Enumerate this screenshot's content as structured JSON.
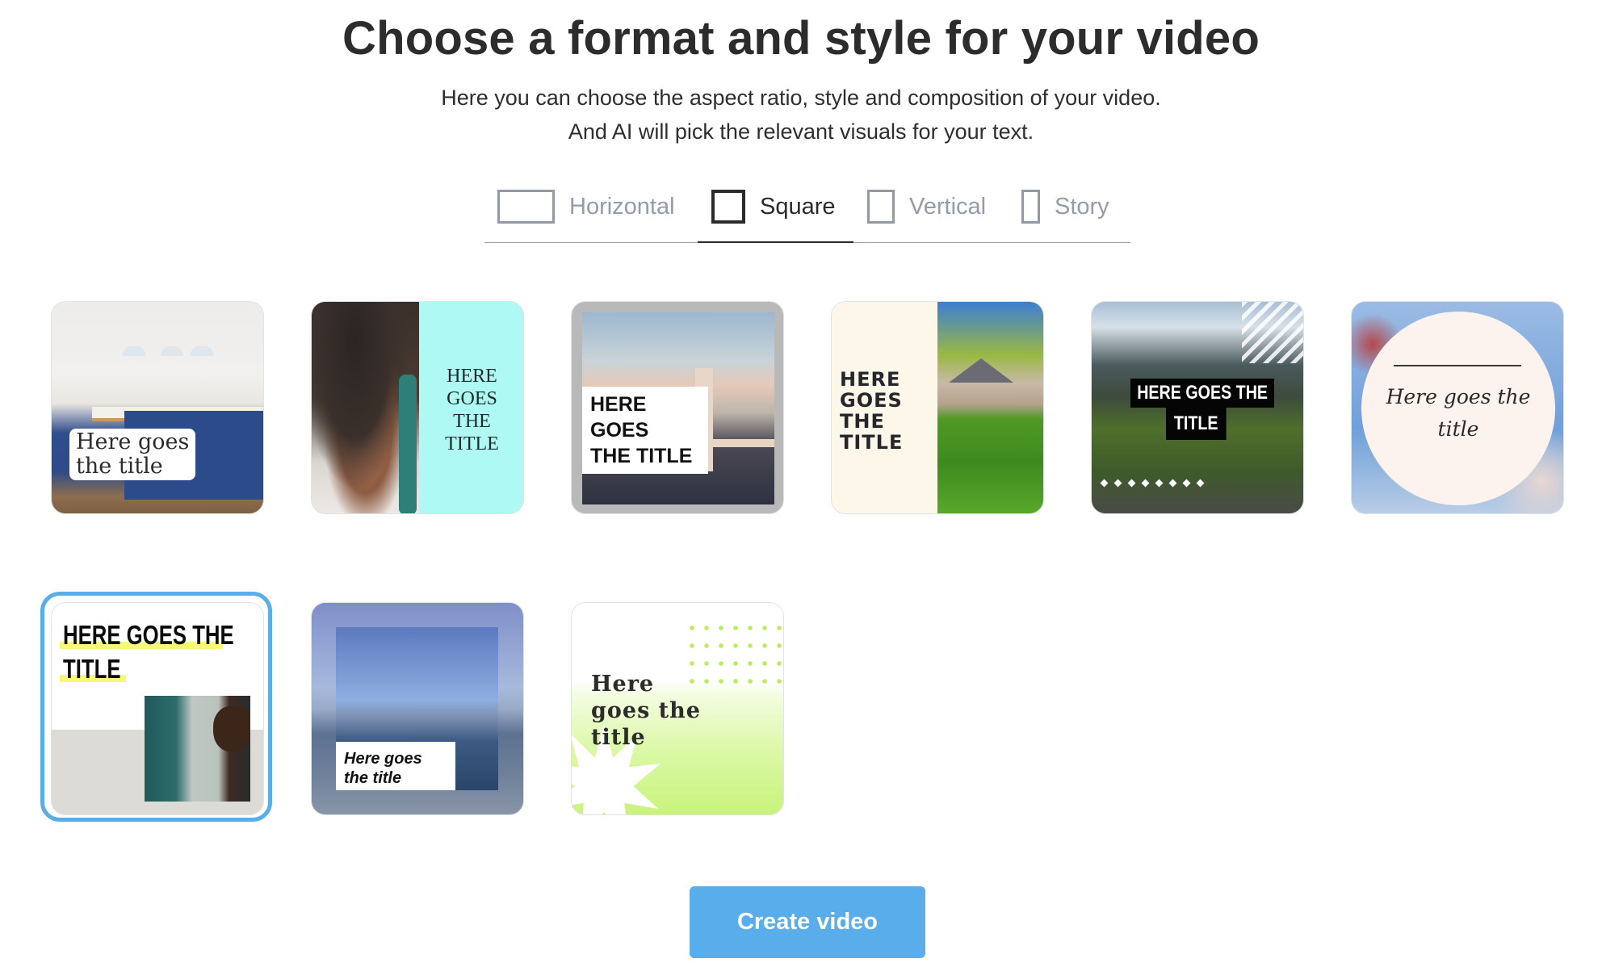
{
  "header": {
    "title": "Choose a format and style for your video",
    "subtitle_line1": "Here you can choose the aspect ratio, style and composition of your video.",
    "subtitle_line2": "And AI will pick the relevant visuals for your text."
  },
  "format_tabs": {
    "selected": "Square",
    "items": [
      {
        "label": "Horizontal",
        "icon": "horizontal-frame-icon",
        "active": false
      },
      {
        "label": "Square",
        "icon": "square-frame-icon",
        "active": true
      },
      {
        "label": "Vertical",
        "icon": "vertical-frame-icon",
        "active": false
      },
      {
        "label": "Story",
        "icon": "story-frame-icon",
        "active": false
      }
    ]
  },
  "templates": {
    "selected_index": 6,
    "items": [
      {
        "title_lines": [
          "Here goes",
          "the title"
        ],
        "scene": "kitchen",
        "selected": false
      },
      {
        "title_lines": [
          "HERE",
          "GOES",
          "THE",
          "TITLE"
        ],
        "scene": "woman-with-phone",
        "accent": "#aef9f3",
        "selected": false
      },
      {
        "title_lines": [
          "HERE GOES",
          "THE TITLE"
        ],
        "scene": "bridge",
        "selected": false
      },
      {
        "title_lines": [
          "HERE",
          "GOES",
          "THE",
          "TITLE"
        ],
        "scene": "house",
        "accent": "#fcf7e9",
        "selected": false
      },
      {
        "title_lines": [
          "HERE GOES THE",
          "TITLE"
        ],
        "scene": "mountains",
        "selected": false
      },
      {
        "title_lines": [
          "Here goes the",
          "title"
        ],
        "scene": "blossom",
        "selected": false
      },
      {
        "title_lines": [
          "HERE GOES THE",
          "TITLE"
        ],
        "scene": "man-portrait",
        "accent": "#f6f77b",
        "selected": true
      },
      {
        "title_lines": [
          "Here goes",
          "the title"
        ],
        "scene": "sea",
        "selected": false
      },
      {
        "title_lines": [
          "Here",
          "goes the",
          "title"
        ],
        "scene": "green-starburst",
        "accent": "#c9f37c",
        "selected": false
      }
    ]
  },
  "actions": {
    "create_label": "Create video",
    "create_color": "#59adea",
    "selection_color": "#5aaee8"
  }
}
